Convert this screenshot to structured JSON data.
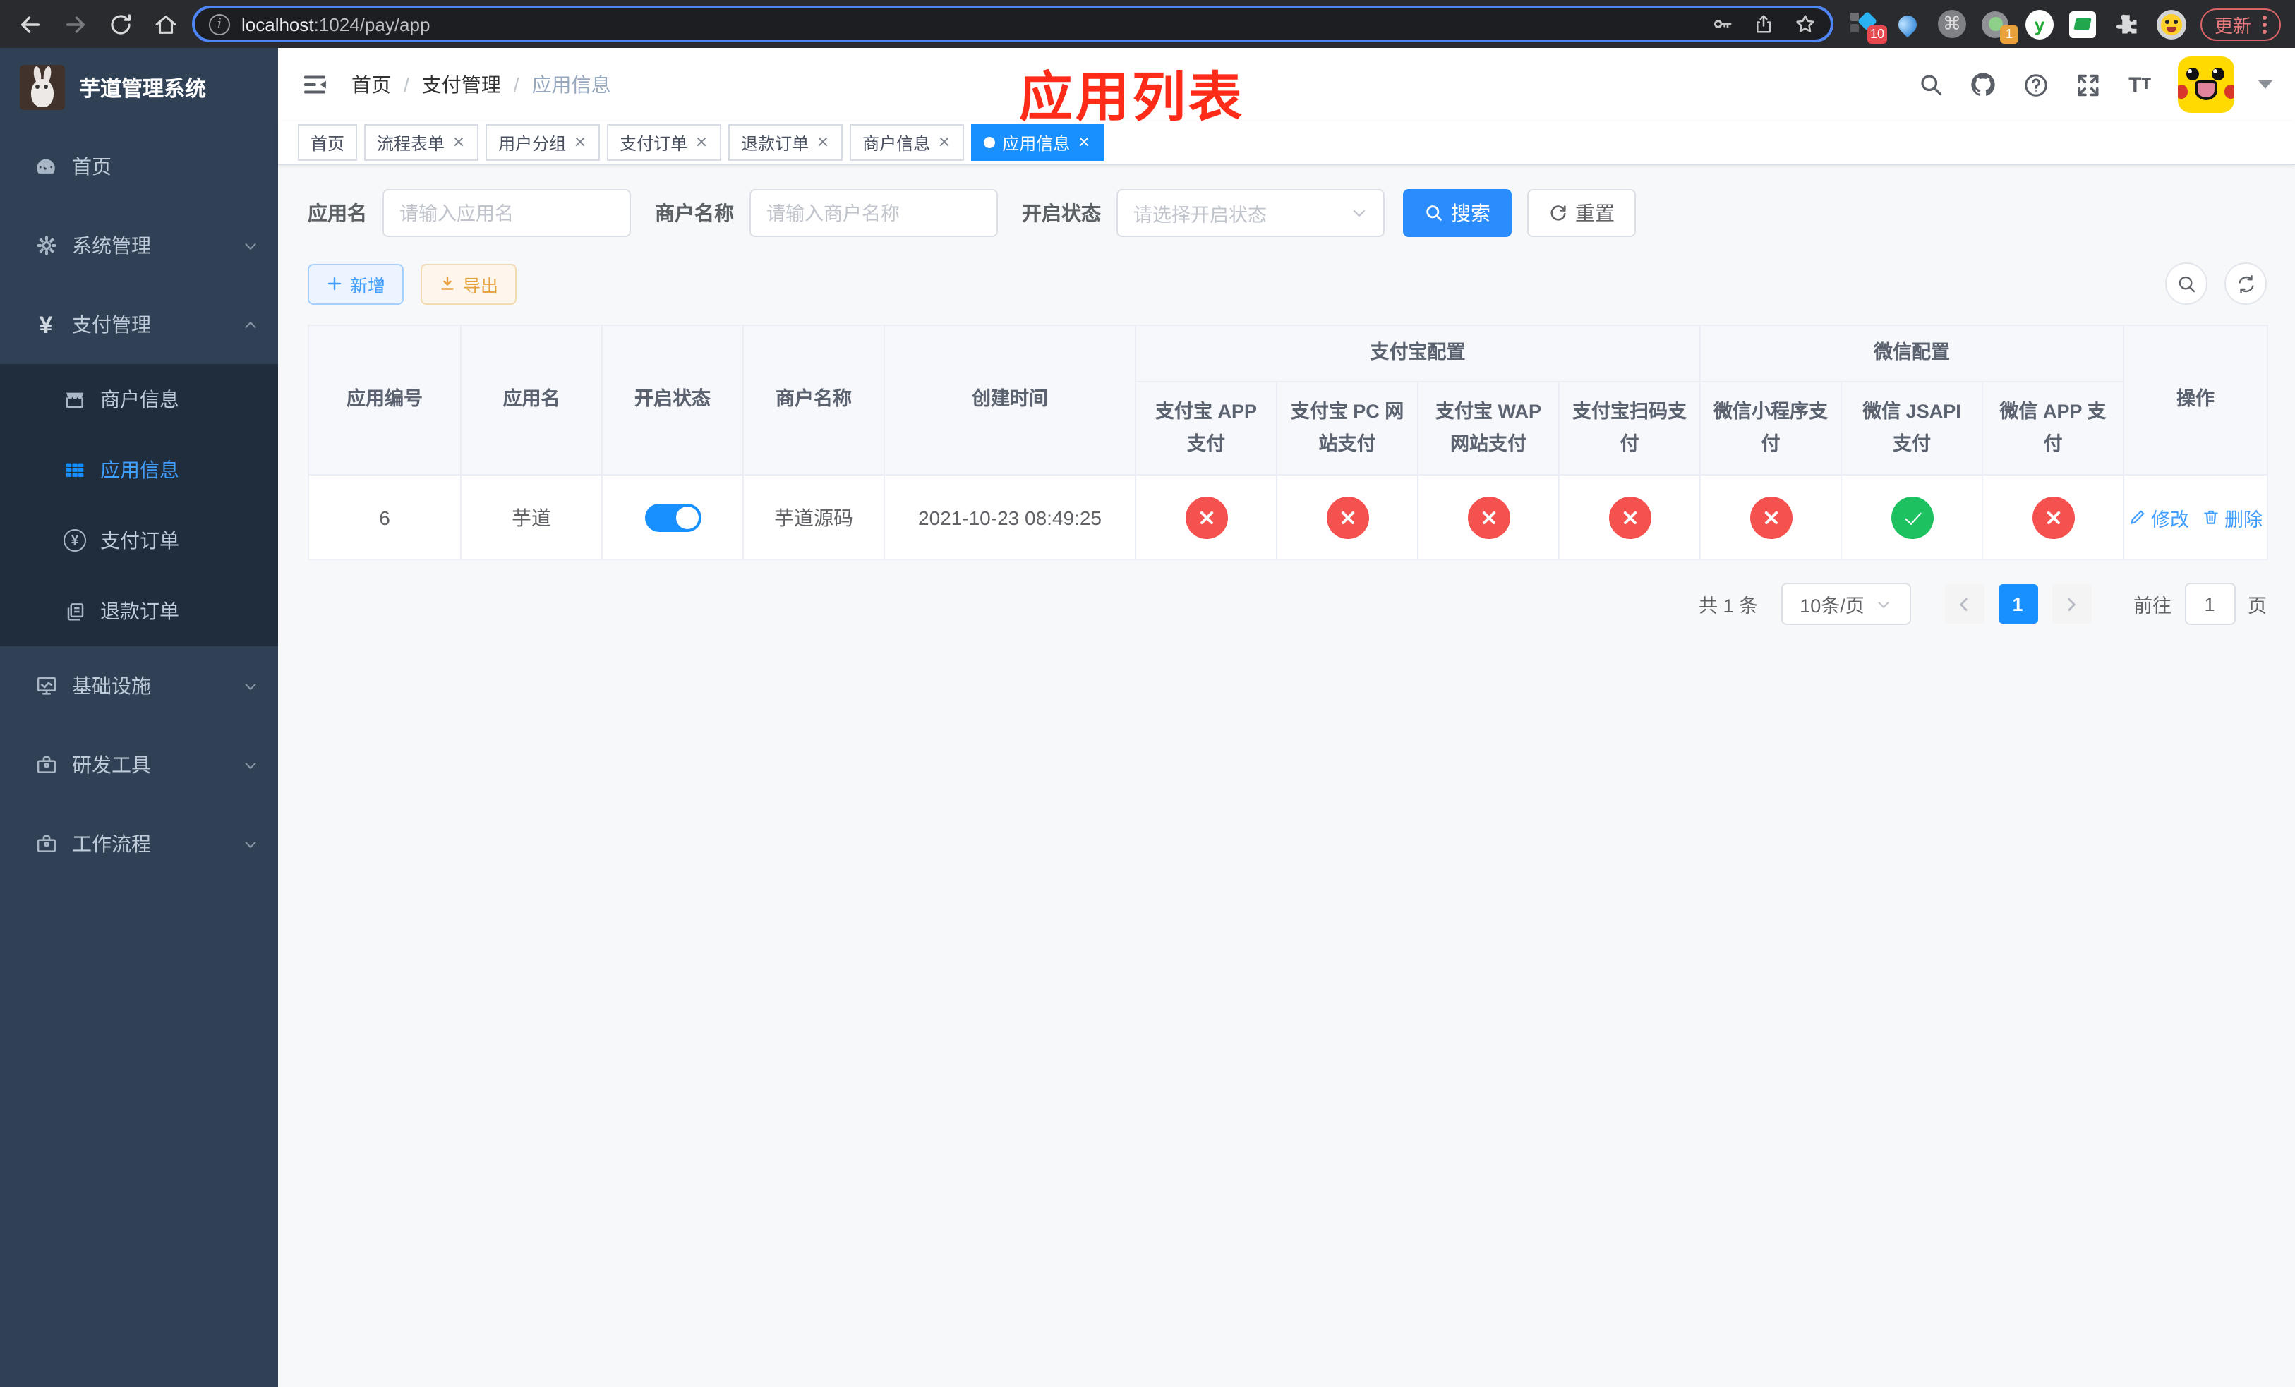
{
  "browser": {
    "url": {
      "host": "localhost",
      "rest": ":1024/pay/app"
    },
    "update_label": "更新",
    "badges": {
      "gem": "10",
      "dot": "1"
    },
    "y_ext_letter": "y"
  },
  "sidebar": {
    "app_title": "芋道管理系统",
    "menu": [
      {
        "label": "首页"
      },
      {
        "label": "系统管理"
      },
      {
        "label": "支付管理"
      },
      {
        "label": "基础设施"
      },
      {
        "label": "研发工具"
      },
      {
        "label": "工作流程"
      }
    ],
    "submenu": [
      {
        "label": "商户信息"
      },
      {
        "label": "应用信息"
      },
      {
        "label": "支付订单"
      },
      {
        "label": "退款订单"
      }
    ]
  },
  "navbar": {
    "breadcrumb": [
      "首页",
      "支付管理",
      "应用信息"
    ],
    "separator": "/",
    "annotation": "应用列表"
  },
  "tabs": [
    {
      "label": "首页"
    },
    {
      "label": "流程表单"
    },
    {
      "label": "用户分组"
    },
    {
      "label": "支付订单"
    },
    {
      "label": "退款订单"
    },
    {
      "label": "商户信息"
    },
    {
      "label": "应用信息"
    }
  ],
  "filters": {
    "app_name_label": "应用名",
    "app_name_placeholder": "请输入应用名",
    "merchant_label": "商户名称",
    "merchant_placeholder": "请输入商户名称",
    "status_label": "开启状态",
    "status_placeholder": "请选择开启状态",
    "search_label": "搜索",
    "reset_label": "重置"
  },
  "toolbar": {
    "add_label": "新增",
    "export_label": "导出"
  },
  "table": {
    "columns": {
      "app_id": "应用编号",
      "app_name": "应用名",
      "status": "开启状态",
      "merchant": "商户名称",
      "create_time": "创建时间",
      "alipay_group": "支付宝配置",
      "wechat_group": "微信配置",
      "alipay_app": "支付宝 APP 支付",
      "alipay_pc": "支付宝 PC 网站支付",
      "alipay_wap": "支付宝 WAP 网站支付",
      "alipay_qr": "支付宝扫码支付",
      "wx_mini": "微信小程序支付",
      "wx_jsapi": "微信 JSAPI 支付",
      "wx_app": "微信 APP 支付",
      "actions": "操作"
    },
    "rows": [
      {
        "app_id": "6",
        "app_name": "芋道",
        "enabled": true,
        "merchant": "芋道源码",
        "create_time": "2021-10-23 08:49:25",
        "pay": {
          "alipay_app": false,
          "alipay_pc": false,
          "alipay_wap": false,
          "alipay_qr": false,
          "wx_mini": false,
          "wx_jsapi": true,
          "wx_app": false
        }
      }
    ],
    "edit_label": "修改",
    "delete_label": "删除"
  },
  "pagination": {
    "total_label": "共 1 条",
    "page_size_label": "10条/页",
    "current_page": "1",
    "goto_label": "前往",
    "goto_value": "1",
    "page_suffix_label": "页"
  }
}
